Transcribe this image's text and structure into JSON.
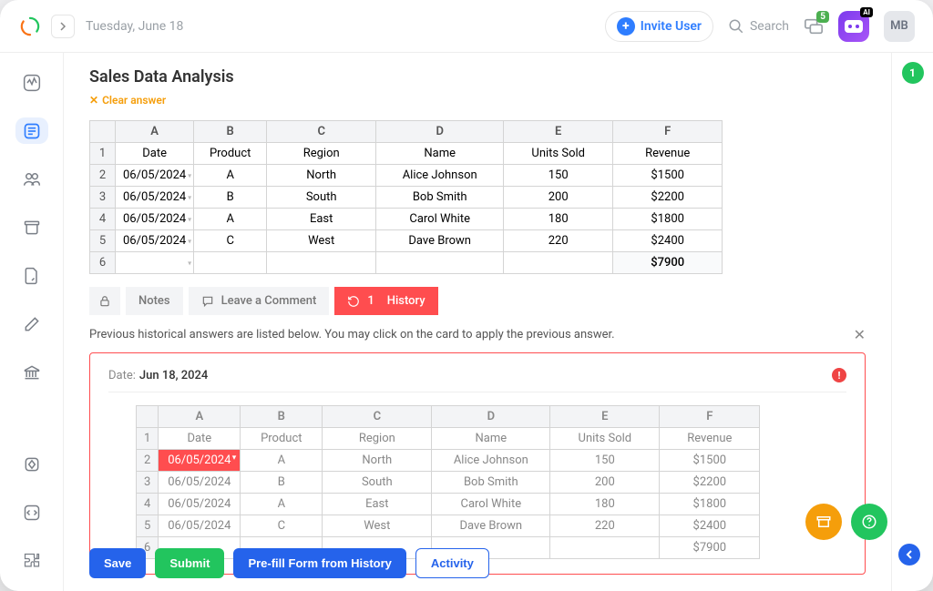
{
  "header": {
    "date": "Tuesday, June 18",
    "invite_label": "Invite User",
    "search_placeholder": "Search",
    "chat_badge": "5",
    "ai_badge": "AI",
    "avatar_initials": "MB"
  },
  "right_rail": {
    "badge": "1"
  },
  "page": {
    "title": "Sales Data Analysis",
    "clear_label": "Clear answer"
  },
  "sheet_main": {
    "col_letters": [
      "A",
      "B",
      "C",
      "D",
      "E",
      "F"
    ],
    "headers": [
      "Date",
      "Product",
      "Region",
      "Name",
      "Units Sold",
      "Revenue"
    ],
    "rows": [
      [
        "06/05/2024",
        "A",
        "North",
        "Alice Johnson",
        "150",
        "$1500"
      ],
      [
        "06/05/2024",
        "B",
        "South",
        "Bob Smith",
        "200",
        "$2200"
      ],
      [
        "06/05/2024",
        "A",
        "East",
        "Carol White",
        "180",
        "$1800"
      ],
      [
        "06/05/2024",
        "C",
        "West",
        "Dave Brown",
        "220",
        "$2400"
      ]
    ],
    "total_row_num": "6",
    "total_revenue": "$7900"
  },
  "tabs": {
    "notes": "Notes",
    "comment": "Leave a Comment",
    "history_count": "1",
    "history_label": "History"
  },
  "history": {
    "intro": "Previous historical answers are listed below. You may click on the card to apply the previous answer.",
    "date_label": "Date:",
    "date_value": "Jun 18, 2024",
    "col_letters": [
      "A",
      "B",
      "C",
      "D",
      "E",
      "F"
    ],
    "headers": [
      "Date",
      "Product",
      "Region",
      "Name",
      "Units Sold",
      "Revenue"
    ],
    "rows": [
      [
        "06/05/2024",
        "A",
        "North",
        "Alice Johnson",
        "150",
        "$1500"
      ],
      [
        "06/05/2024",
        "B",
        "South",
        "Bob Smith",
        "200",
        "$2200"
      ],
      [
        "06/05/2024",
        "A",
        "East",
        "Carol White",
        "180",
        "$1800"
      ],
      [
        "06/05/2024",
        "C",
        "West",
        "Dave Brown",
        "220",
        "$2400"
      ]
    ],
    "total_revenue": "$7900"
  },
  "footer": {
    "save": "Save",
    "submit": "Submit",
    "prefill": "Pre-fill Form from History",
    "activity": "Activity"
  }
}
